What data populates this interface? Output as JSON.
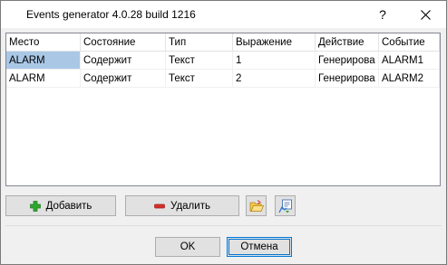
{
  "window": {
    "title": "Events generator 4.0.28 build 1216",
    "help_label": "?"
  },
  "table": {
    "columns": [
      "Место",
      "Состояние",
      "Тип",
      "Выражение",
      "Действие",
      "Событие"
    ],
    "rows": [
      [
        "ALARM",
        "Содержит",
        "Текст",
        "1",
        "Генерирова",
        "ALARM1"
      ],
      [
        "ALARM",
        "Содержит",
        "Текст",
        "2",
        "Генерирова",
        "ALARM2"
      ]
    ],
    "selected_cell": "0.0"
  },
  "toolbar": {
    "add_label": "Добавить",
    "delete_label": "Удалить",
    "open_icon": "folder-open-icon",
    "generate_icon": "generate-icon"
  },
  "footer": {
    "ok_label": "OK",
    "cancel_label": "Отмена"
  },
  "colors": {
    "selection": "#aac8e6",
    "focus_border": "#0078d7",
    "add_icon": "#2ea82e",
    "delete_icon": "#d9302c"
  }
}
